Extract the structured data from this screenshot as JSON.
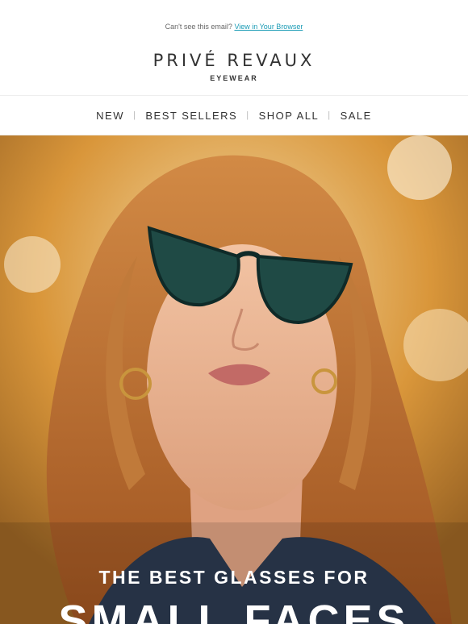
{
  "preheader": {
    "text": "Can't see this email?",
    "link": "View in Your Browser"
  },
  "brand": {
    "name": "PRIVÉ REVAUX",
    "subtitle": "EYEWEAR"
  },
  "nav": {
    "items": [
      "NEW",
      "BEST SELLERS",
      "SHOP ALL",
      "SALE"
    ]
  },
  "hero": {
    "headline_line1": "THE BEST GLASSES FOR",
    "headline_line2": "SMALL FACES"
  },
  "colors": {
    "link": "#1a9bb5",
    "background_warm": "#d69232",
    "hair": "#b8652a",
    "lens_frame": "#1f4a45"
  }
}
